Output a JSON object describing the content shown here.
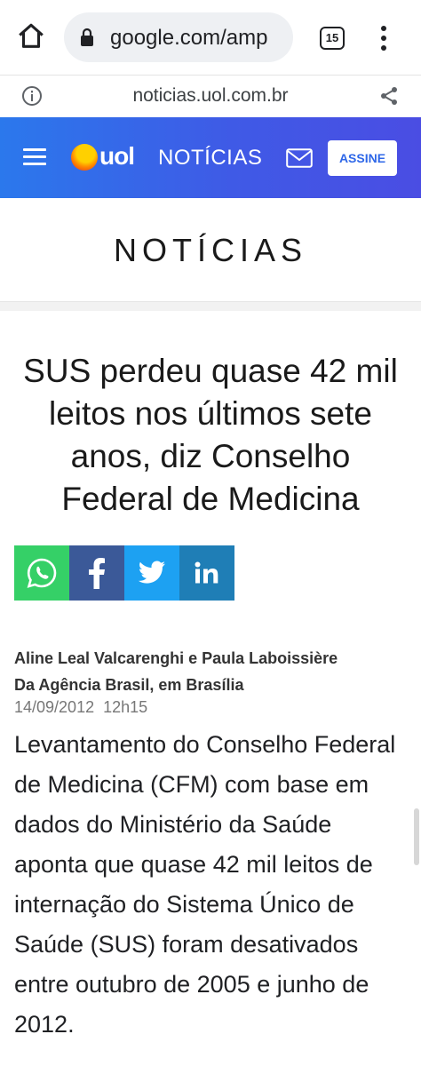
{
  "browser": {
    "url": "google.com/amp",
    "tab_count": "15"
  },
  "amp_bar": {
    "domain": "noticias.uol.com.br"
  },
  "header": {
    "logo_text": "uol",
    "section": "NOTÍCIAS",
    "subscribe_label": "ASSINE",
    "colors": {
      "gradient_start": "#2b78ec",
      "gradient_end": "#4a4de3"
    }
  },
  "section_title": "NOTÍCIAS",
  "article": {
    "headline": "SUS perdeu quase 42 mil leitos nos últimos sete anos, diz Conselho Federal de Medicina",
    "share_buttons": [
      {
        "network": "whatsapp",
        "icon": "whatsapp-icon",
        "color": "#35d067"
      },
      {
        "network": "facebook",
        "icon": "facebook-icon",
        "color": "#3b5998"
      },
      {
        "network": "twitter",
        "icon": "twitter-icon",
        "color": "#1da1f2"
      },
      {
        "network": "linkedin",
        "icon": "linkedin-icon",
        "color": "#1f7eb6"
      }
    ],
    "authors": "Aline Leal Valcarenghi e Paula Laboissière",
    "source": "Da Agência Brasil, em Brasília",
    "date": "14/09/2012",
    "time": "12h15",
    "body": "Levantamento do Conselho Federal de Medicina (CFM) com base em dados do Ministério da Saúde aponta que quase 42 mil leitos de internação do Sistema Único de Saúde (SUS) foram desativados entre outubro de 2005 e junho de 2012."
  }
}
